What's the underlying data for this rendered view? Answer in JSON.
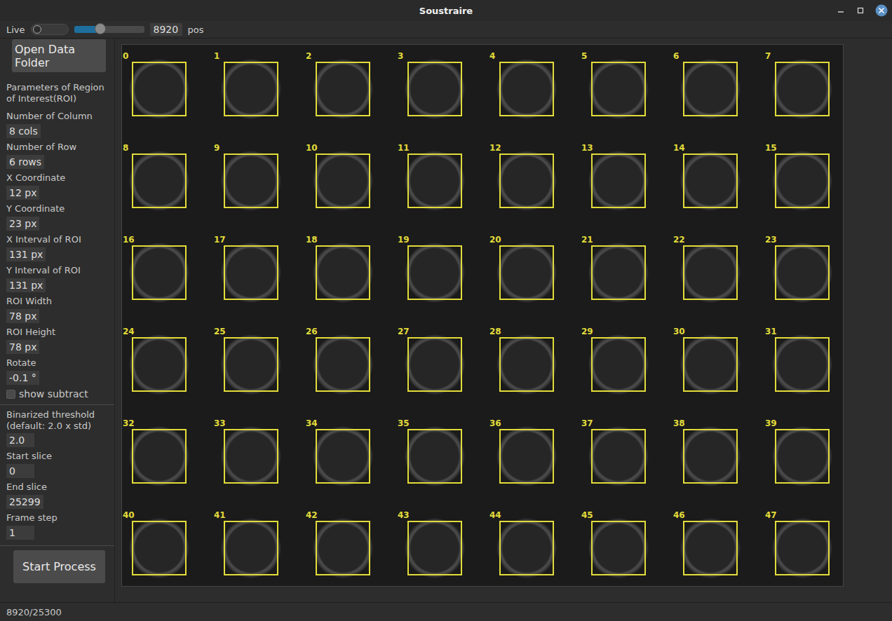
{
  "window": {
    "title": "Soustraire"
  },
  "toolbar": {
    "live": {
      "label": "Live",
      "on": false
    },
    "slider": {
      "level": 0.37
    },
    "position": "8920",
    "unit": "pos"
  },
  "sidebar": {
    "open_button": "Open Data Folder",
    "roi_heading": "Parameters of Region of Interest(ROI)",
    "roi_params": [
      {
        "label": "Number of Column",
        "value": "8 cols"
      },
      {
        "label": "Number of Row",
        "value": "6 rows"
      },
      {
        "label": "X Coordinate",
        "value": "12 px"
      },
      {
        "label": "Y Coordinate",
        "value": "23 px"
      },
      {
        "label": "X Interval of ROI",
        "value": "131 px"
      },
      {
        "label": "Y Interval of ROI",
        "value": "131 px"
      },
      {
        "label": "ROI Width",
        "value": "78 px"
      },
      {
        "label": "ROI Height",
        "value": "78 px"
      },
      {
        "label": "Rotate",
        "value": "-0.1 °"
      }
    ],
    "show_subtract": {
      "label": "show subtract",
      "checked": false
    },
    "process_params": [
      {
        "label": "Binarized threshold (default: 2.0 x std)",
        "value": "2.0"
      },
      {
        "label": "Start slice",
        "value": "0"
      },
      {
        "label": "End slice",
        "value": "25299"
      },
      {
        "label": "Frame step",
        "value": "1"
      }
    ],
    "start_button": "Start Process"
  },
  "viewer": {
    "rois": [
      {
        "label": "0"
      },
      {
        "label": "1"
      },
      {
        "label": "2"
      },
      {
        "label": "3"
      },
      {
        "label": "4"
      },
      {
        "label": "5"
      },
      {
        "label": "6"
      },
      {
        "label": "7"
      },
      {
        "label": "8"
      },
      {
        "label": "9"
      },
      {
        "label": "10"
      },
      {
        "label": "11"
      },
      {
        "label": "12"
      },
      {
        "label": "13"
      },
      {
        "label": "14"
      },
      {
        "label": "15"
      },
      {
        "label": "16"
      },
      {
        "label": "17"
      },
      {
        "label": "18"
      },
      {
        "label": "19"
      },
      {
        "label": "20"
      },
      {
        "label": "21"
      },
      {
        "label": "22"
      },
      {
        "label": "23"
      },
      {
        "label": "24"
      },
      {
        "label": "25"
      },
      {
        "label": "26"
      },
      {
        "label": "27"
      },
      {
        "label": "28"
      },
      {
        "label": "29"
      },
      {
        "label": "30"
      },
      {
        "label": "31"
      },
      {
        "label": "32"
      },
      {
        "label": "33"
      },
      {
        "label": "34"
      },
      {
        "label": "35"
      },
      {
        "label": "36"
      },
      {
        "label": "37"
      },
      {
        "label": "38"
      },
      {
        "label": "39"
      },
      {
        "label": "40"
      },
      {
        "label": "41"
      },
      {
        "label": "42"
      },
      {
        "label": "43"
      },
      {
        "label": "44"
      },
      {
        "label": "45"
      },
      {
        "label": "46"
      },
      {
        "label": "47"
      }
    ]
  },
  "status_bar": "8920/25300"
}
